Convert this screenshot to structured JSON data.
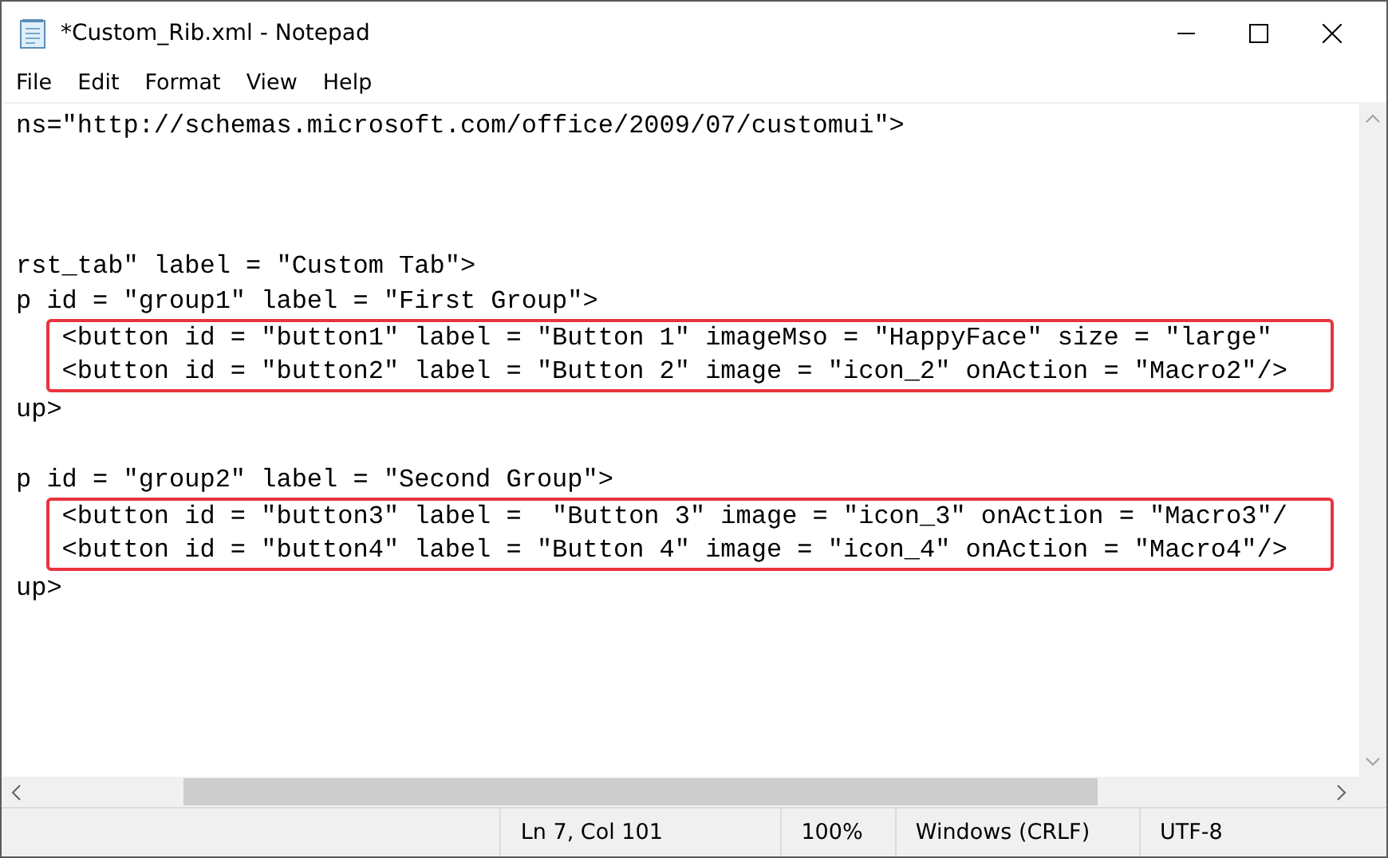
{
  "window": {
    "title": "*Custom_Rib.xml - Notepad"
  },
  "menu": [
    "File",
    "Edit",
    "Format",
    "View",
    "Help"
  ],
  "editor": {
    "blocks": [
      {
        "kind": "line",
        "text": "ns=\"http://schemas.microsoft.com/office/2009/07/customui\">"
      },
      {
        "kind": "blank"
      },
      {
        "kind": "blank"
      },
      {
        "kind": "blank"
      },
      {
        "kind": "line",
        "text": "rst_tab\" label = \"Custom Tab\">"
      },
      {
        "kind": "line",
        "text": "p id = \"group1\" label = \"First Group\">"
      },
      {
        "kind": "highlight",
        "lines": [
          "   <button id = \"button1\" label = \"Button 1\" imageMso = \"HappyFace\" size = \"large\"",
          "   <button id = \"button2\" label = \"Button 2\" image = \"icon_2\" onAction = \"Macro2\"/>"
        ]
      },
      {
        "kind": "line",
        "text": "up>"
      },
      {
        "kind": "blank"
      },
      {
        "kind": "line",
        "text": "p id = \"group2\" label = \"Second Group\">"
      },
      {
        "kind": "highlight",
        "lines": [
          "   <button id = \"button3\" label =  \"Button 3\" image = \"icon_3\" onAction = \"Macro3\"/",
          "   <button id = \"button4\" label = \"Button 4\" image = \"icon_4\" onAction = \"Macro4\"/>"
        ]
      },
      {
        "kind": "line",
        "text": "up>"
      }
    ]
  },
  "status_bar": [
    "Ln 7, Col 101",
    "100%",
    "Windows (CRLF)",
    "UTF-8"
  ]
}
